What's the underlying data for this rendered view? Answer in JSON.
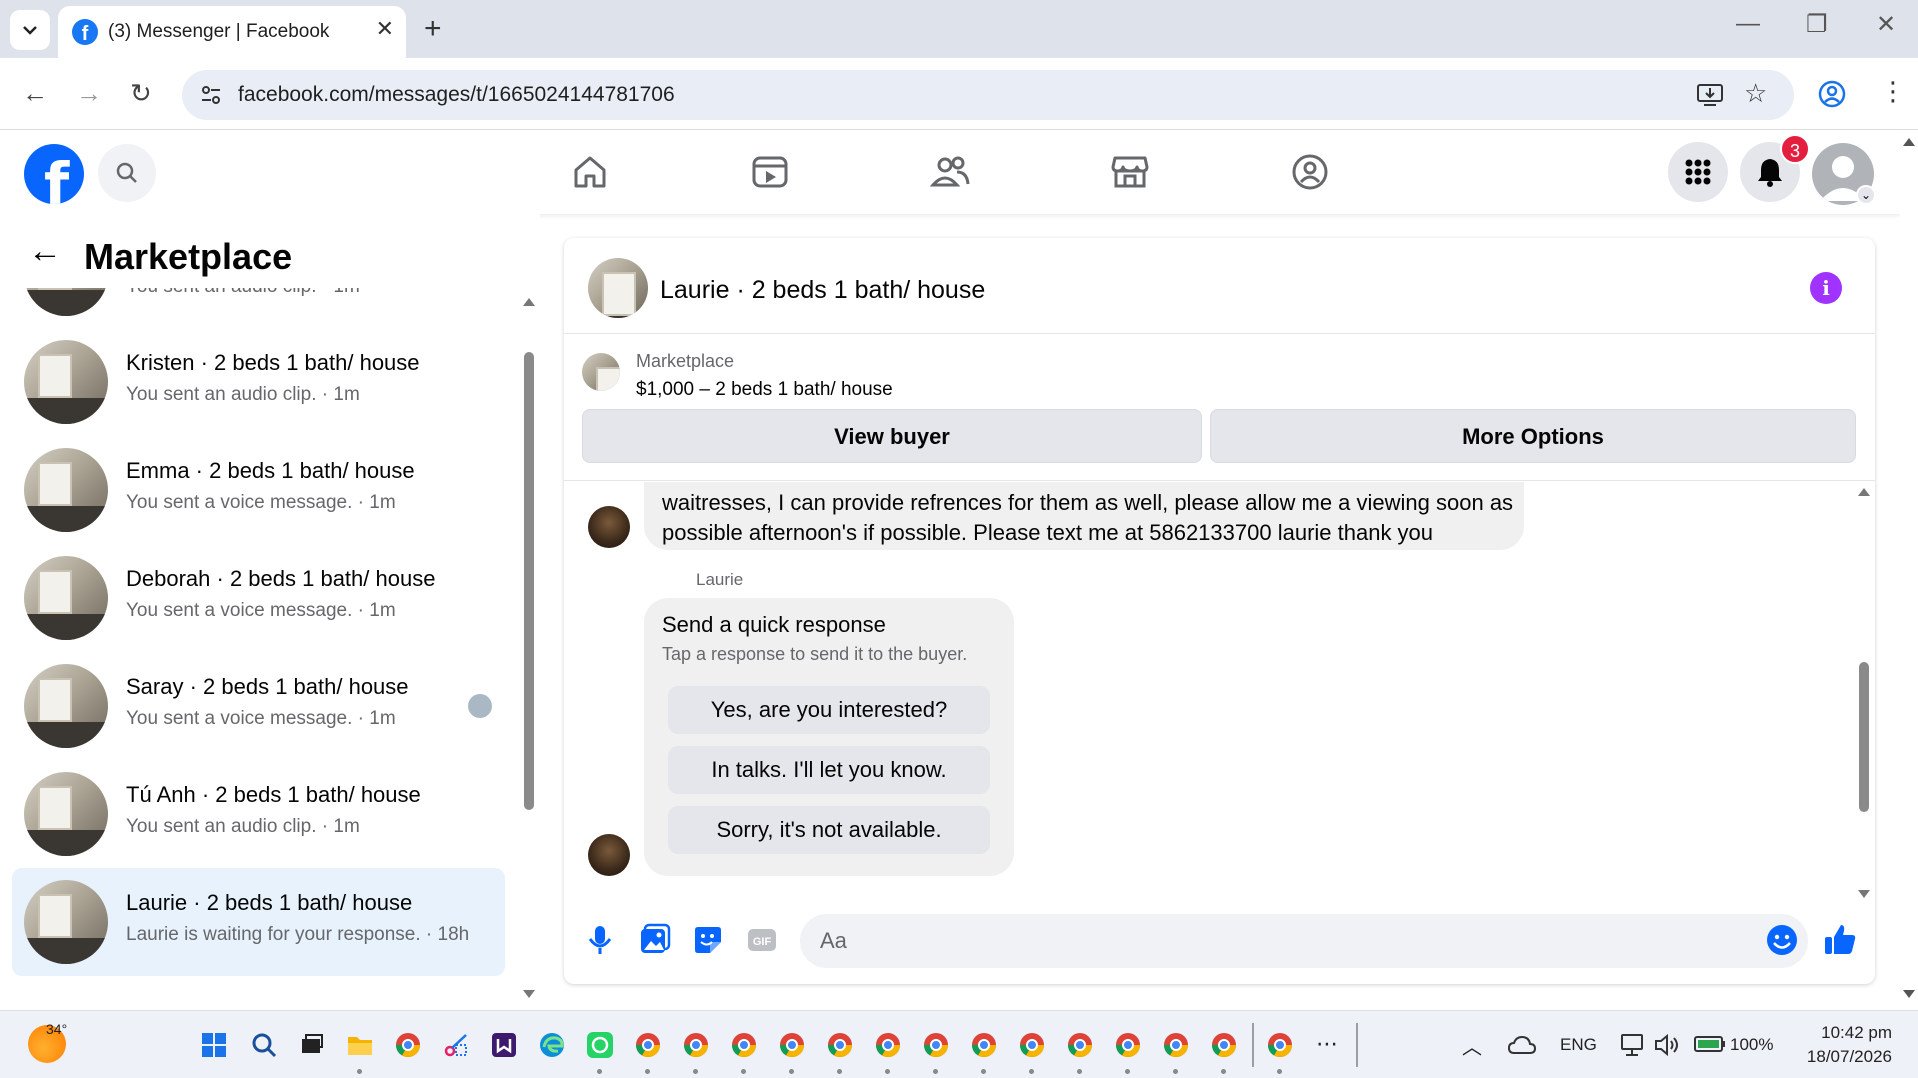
{
  "browser": {
    "tab_title": "(3) Messenger | Facebook",
    "url": "facebook.com/messages/t/1665024144781706"
  },
  "fb_nav": {
    "notification_count": "3",
    "items": [
      "home-icon",
      "video-icon",
      "friends-icon",
      "marketplace-icon",
      "groups-icon"
    ]
  },
  "left_panel": {
    "heading": "Marketplace",
    "conversations": [
      {
        "name": "",
        "preview": "You sent an audio clip. · 1m"
      },
      {
        "name": "Kristen · 2 beds 1 bath/ house",
        "preview": "You sent an audio clip. · 1m"
      },
      {
        "name": "Emma · 2 beds 1 bath/ house",
        "preview": "You sent a voice message. · 1m"
      },
      {
        "name": "Deborah · 2 beds 1 bath/ house",
        "preview": "You sent a voice message. · 1m"
      },
      {
        "name": "Saray · 2 beds 1 bath/ house",
        "preview": "You sent a voice message. · 1m"
      },
      {
        "name": "Tú Anh · 2 beds 1 bath/ house",
        "preview": "You sent an audio clip. · 1m"
      },
      {
        "name": "Laurie · 2 beds 1 bath/ house",
        "preview": "Laurie is waiting for your response. · 18h"
      }
    ]
  },
  "chat": {
    "title": "Laurie · 2 beds 1 bath/ house",
    "listing_category": "Marketplace",
    "listing_title": "$1,000 – 2 beds 1 bath/ house",
    "view_buyer_label": "View buyer",
    "more_options_label": "More Options",
    "message_text": "waitresses, I can provide refrences for them as well, please allow me a viewing soon as possible afternoon's if possible. Please text me at 5862133700 laurie thank you",
    "sender_name": "Laurie",
    "quick_response": {
      "title": "Send a quick response",
      "subtitle": "Tap a response to send it to the buyer.",
      "options": [
        "Yes, are you interested?",
        "In talks. I'll let you know.",
        "Sorry, it's not available."
      ]
    },
    "input_placeholder": "Aa"
  },
  "taskbar": {
    "temperature": "34°",
    "language": "ENG",
    "battery": "100%",
    "time": "10:42 pm",
    "date": "18/07/2026"
  },
  "colors": {
    "facebook_blue": "#0866ff",
    "selected_row": "#e8f2fd",
    "info_purple": "#a033ff",
    "badge_red": "#e41e3f"
  }
}
